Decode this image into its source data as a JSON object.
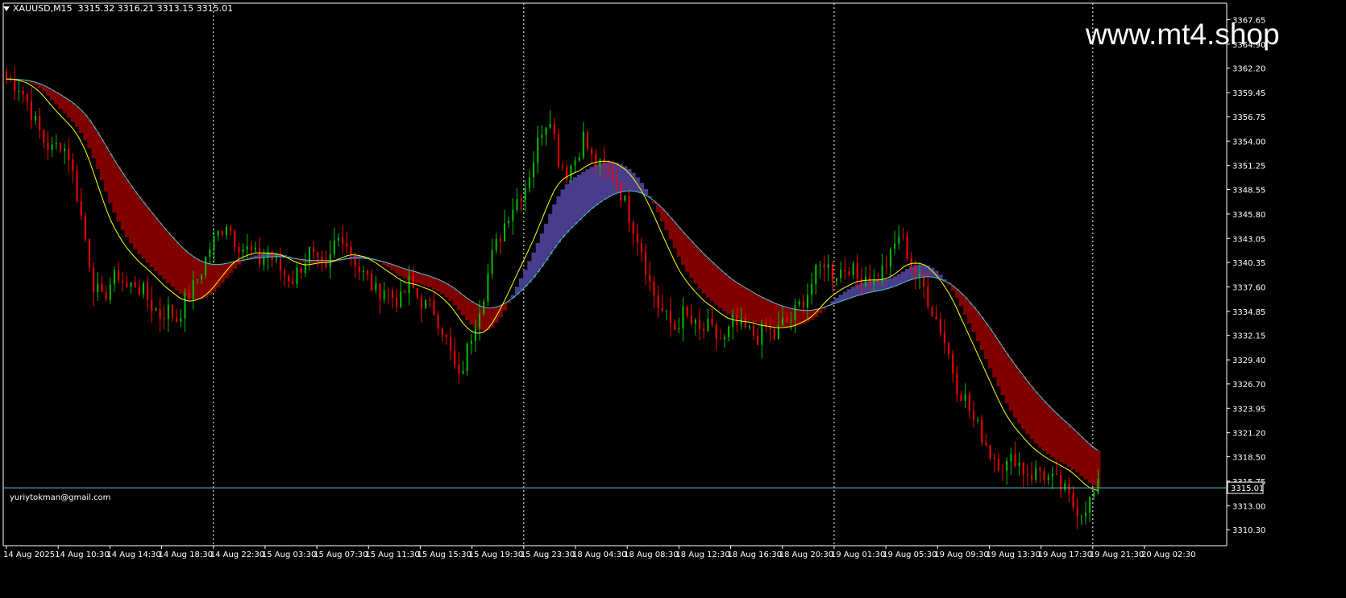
{
  "header": {
    "symbol": "XAUUSD,M15",
    "open": "3315.32",
    "high": "3316.21",
    "low": "3313.15",
    "close": "3315.01"
  },
  "watermark": "www.mt4.shop",
  "author": "yuriytokman@gmail.com",
  "price_tag": "3315.01",
  "colors": {
    "background": "#000000",
    "bull": "#00c000",
    "bear": "#ff0000",
    "cloud_bear": "#800000",
    "cloud_bull": "#483d8b",
    "ma_fast": "#ffff00",
    "ma_slow": "#4fc3d6",
    "grid": "#ffffff",
    "axis": "#ffffff"
  },
  "chart_data": {
    "type": "candlestick",
    "symbol": "XAUUSD",
    "timeframe": "M15",
    "title": "XAUUSD,M15",
    "ylim": [
      3308.5,
      3369.5
    ],
    "current_price": 3315.01,
    "y_ticks": [
      "3367.65",
      "3364.90",
      "3362.20",
      "3359.45",
      "3356.75",
      "3354.00",
      "3351.25",
      "3348.55",
      "3345.80",
      "3343.05",
      "3340.35",
      "3337.60",
      "3334.85",
      "3332.15",
      "3329.40",
      "3326.70",
      "3323.95",
      "3321.20",
      "3318.50",
      "3315.75",
      "3313.00",
      "3310.30"
    ],
    "x_ticks": [
      "14 Aug 2025",
      "14 Aug 10:30",
      "14 Aug 14:30",
      "14 Aug 18:30",
      "14 Aug 22:30",
      "15 Aug 03:30",
      "15 Aug 07:30",
      "15 Aug 11:30",
      "15 Aug 15:30",
      "15 Aug 19:30",
      "15 Aug 23:30",
      "18 Aug 04:30",
      "18 Aug 08:30",
      "18 Aug 12:30",
      "18 Aug 16:30",
      "18 Aug 20:30",
      "19 Aug 01:30",
      "19 Aug 05:30",
      "19 Aug 09:30",
      "19 Aug 13:30",
      "19 Aug 17:30",
      "19 Aug 21:30",
      "20 Aug 02:30"
    ],
    "separators_after": [
      "14 Aug 22:30",
      "15 Aug 23:30",
      "19 Aug 01:30",
      "19 Aug 21:30"
    ],
    "price_path": [
      [
        0,
        3361.0
      ],
      [
        3,
        3360.2
      ],
      [
        5,
        3358.5
      ],
      [
        7,
        3356.0
      ],
      [
        9,
        3354.0
      ],
      [
        11,
        3353.0
      ],
      [
        13,
        3353.8
      ],
      [
        15,
        3352.5
      ],
      [
        17,
        3348.0
      ],
      [
        19,
        3343.0
      ],
      [
        21,
        3338.0
      ],
      [
        23,
        3336.0
      ],
      [
        25,
        3338.0
      ],
      [
        27,
        3339.0
      ],
      [
        29,
        3337.5
      ],
      [
        31,
        3338.0
      ],
      [
        33,
        3337.0
      ],
      [
        35,
        3335.5
      ],
      [
        37,
        3334.5
      ],
      [
        39,
        3335.0
      ],
      [
        41,
        3334.0
      ],
      [
        43,
        3336.0
      ],
      [
        45,
        3337.5
      ],
      [
        47,
        3339.5
      ],
      [
        49,
        3342.0
      ],
      [
        51,
        3343.5
      ],
      [
        53,
        3345.0
      ],
      [
        55,
        3343.0
      ],
      [
        57,
        3342.0
      ],
      [
        59,
        3341.5
      ],
      [
        61,
        3340.5
      ],
      [
        63,
        3341.5
      ],
      [
        65,
        3340.0
      ],
      [
        67,
        3339.0
      ],
      [
        69,
        3338.5
      ],
      [
        71,
        3340.0
      ],
      [
        73,
        3341.5
      ],
      [
        75,
        3340.0
      ],
      [
        77,
        3339.0
      ],
      [
        79,
        3342.5
      ],
      [
        81,
        3343.5
      ],
      [
        83,
        3341.5
      ],
      [
        85,
        3339.5
      ],
      [
        87,
        3338.5
      ],
      [
        89,
        3337.0
      ],
      [
        91,
        3337.5
      ],
      [
        93,
        3336.5
      ],
      [
        95,
        3336.0
      ],
      [
        97,
        3338.0
      ],
      [
        99,
        3336.5
      ],
      [
        101,
        3335.5
      ],
      [
        103,
        3335.0
      ],
      [
        105,
        3333.0
      ],
      [
        107,
        3330.0
      ],
      [
        109,
        3327.0
      ],
      [
        111,
        3330.5
      ],
      [
        113,
        3334.0
      ],
      [
        115,
        3337.0
      ],
      [
        117,
        3341.0
      ],
      [
        119,
        3343.5
      ],
      [
        121,
        3346.0
      ],
      [
        123,
        3347.5
      ],
      [
        125,
        3349.0
      ],
      [
        127,
        3352.0
      ],
      [
        129,
        3355.5
      ],
      [
        131,
        3357.0
      ],
      [
        133,
        3352.0
      ],
      [
        135,
        3350.5
      ],
      [
        137,
        3352.0
      ],
      [
        139,
        3354.5
      ],
      [
        141,
        3352.0
      ],
      [
        143,
        3351.0
      ],
      [
        145,
        3350.5
      ],
      [
        147,
        3349.5
      ],
      [
        149,
        3347.0
      ],
      [
        151,
        3344.5
      ],
      [
        153,
        3342.0
      ],
      [
        155,
        3338.0
      ],
      [
        157,
        3335.5
      ],
      [
        159,
        3334.0
      ],
      [
        161,
        3333.0
      ],
      [
        163,
        3334.5
      ],
      [
        165,
        3333.5
      ],
      [
        167,
        3332.5
      ],
      [
        169,
        3333.0
      ],
      [
        171,
        3332.0
      ],
      [
        173,
        3331.5
      ],
      [
        175,
        3333.5
      ],
      [
        177,
        3333.0
      ],
      [
        179,
        3332.5
      ],
      [
        181,
        3332.0
      ],
      [
        183,
        3333.0
      ],
      [
        185,
        3332.0
      ],
      [
        187,
        3333.5
      ],
      [
        189,
        3334.0
      ],
      [
        191,
        3335.5
      ],
      [
        193,
        3337.0
      ],
      [
        195,
        3339.0
      ],
      [
        197,
        3340.5
      ],
      [
        199,
        3339.0
      ],
      [
        201,
        3339.5
      ],
      [
        203,
        3340.0
      ],
      [
        205,
        3338.5
      ],
      [
        207,
        3339.0
      ],
      [
        209,
        3338.0
      ],
      [
        211,
        3339.5
      ],
      [
        213,
        3341.0
      ],
      [
        215,
        3343.5
      ],
      [
        217,
        3341.5
      ],
      [
        219,
        3339.0
      ],
      [
        221,
        3337.5
      ],
      [
        223,
        3335.0
      ],
      [
        225,
        3333.0
      ],
      [
        227,
        3330.0
      ],
      [
        229,
        3326.5
      ],
      [
        231,
        3325.0
      ],
      [
        233,
        3322.5
      ],
      [
        235,
        3321.0
      ],
      [
        237,
        3319.0
      ],
      [
        239,
        3318.0
      ],
      [
        241,
        3317.5
      ],
      [
        243,
        3318.5
      ],
      [
        245,
        3317.0
      ],
      [
        247,
        3316.5
      ],
      [
        249,
        3317.0
      ],
      [
        251,
        3316.0
      ],
      [
        253,
        3315.5
      ],
      [
        255,
        3314.5
      ],
      [
        257,
        3313.0
      ],
      [
        259,
        3312.5
      ],
      [
        261,
        3313.5
      ],
      [
        263,
        3315.0
      ]
    ]
  }
}
